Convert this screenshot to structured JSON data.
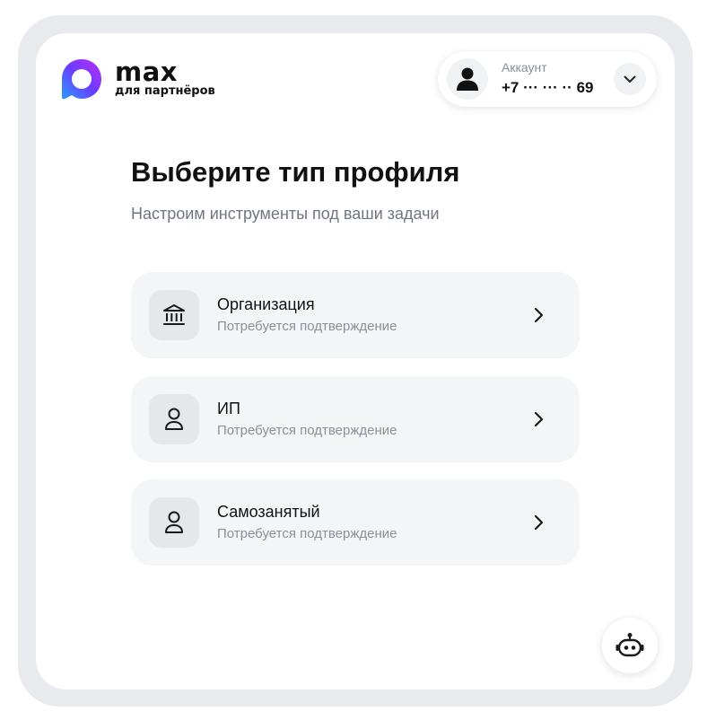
{
  "brand": {
    "name": "max",
    "subtitle": "для партнёров",
    "colors": {
      "gradient_start": "#1f8cff",
      "gradient_mid": "#6a3cff",
      "gradient_end": "#b02cff"
    }
  },
  "account": {
    "label": "Аккаунт",
    "phone": "+7 ··· ··· ·· 69",
    "avatar_icon": "user-icon",
    "toggle_icon": "chevron-down-icon"
  },
  "page": {
    "title": "Выберите тип профиля",
    "subtitle": "Настроим инструменты под ваши задачи"
  },
  "options": [
    {
      "title": "Организация",
      "description": "Потребуется подтверждение",
      "icon": "bank-icon"
    },
    {
      "title": "ИП",
      "description": "Потребуется подтверждение",
      "icon": "person-icon"
    },
    {
      "title": "Самозанятый",
      "description": "Потребуется подтверждение",
      "icon": "person-icon"
    }
  ],
  "assistant": {
    "icon": "robot-icon"
  }
}
